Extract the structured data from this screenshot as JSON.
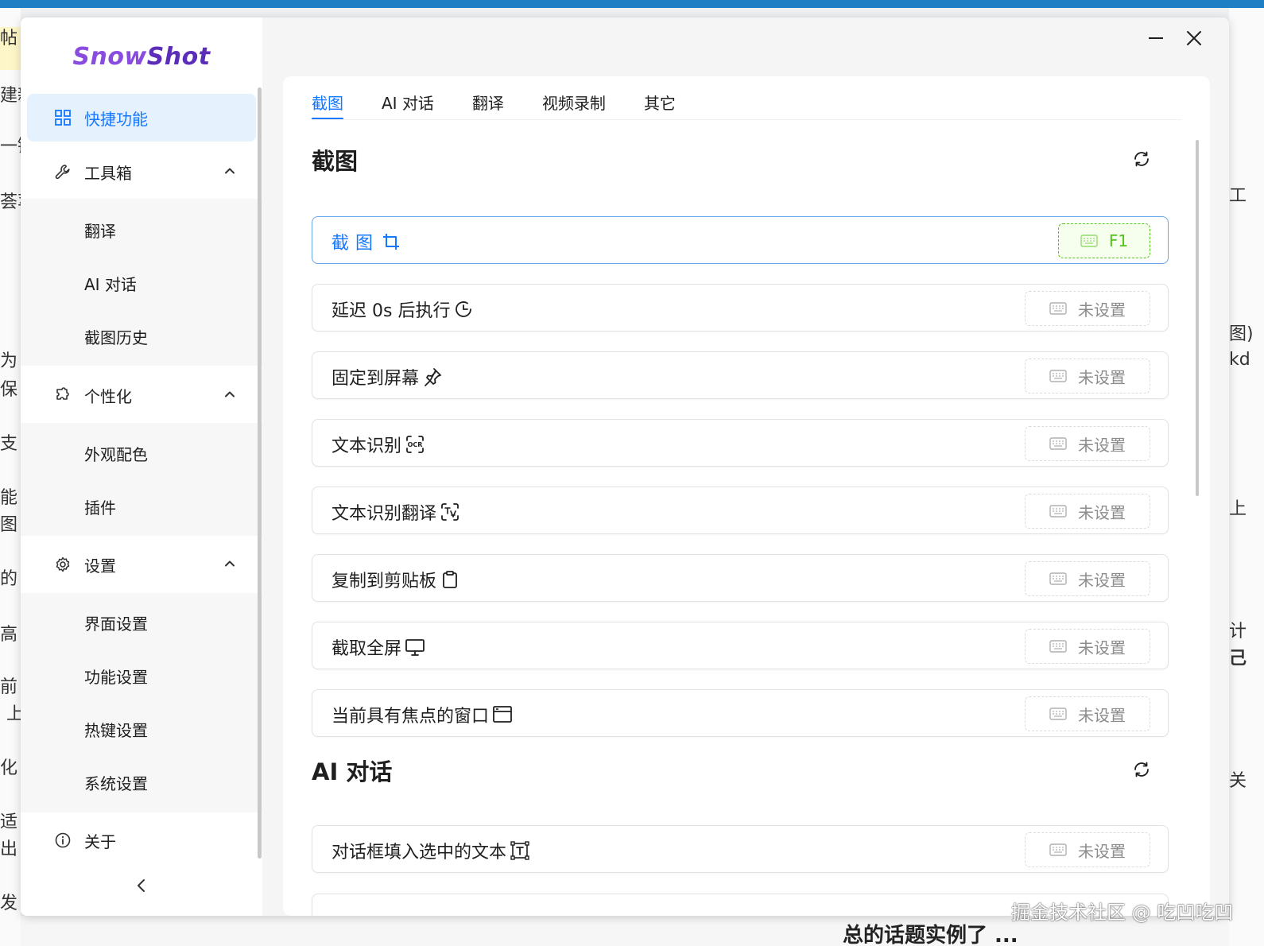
{
  "app": {
    "logo_snow": "Snow",
    "logo_shot": "Shot"
  },
  "sidebar": {
    "items": [
      {
        "label": "快捷功能",
        "icon": "grid-icon"
      },
      {
        "label": "工具箱",
        "icon": "wrench-icon"
      },
      {
        "label": "个性化",
        "icon": "puzzle-icon"
      },
      {
        "label": "设置",
        "icon": "gear-icon"
      },
      {
        "label": "关于",
        "icon": "info-icon"
      }
    ],
    "toolbox": [
      "翻译",
      "AI 对话",
      "截图历史"
    ],
    "personalize": [
      "外观配色",
      "插件"
    ],
    "settings": [
      "界面设置",
      "功能设置",
      "热键设置",
      "系统设置"
    ]
  },
  "tabs": [
    "截图",
    "AI 对话",
    "翻译",
    "视频录制",
    "其它"
  ],
  "sections": [
    {
      "title": "截图",
      "rows": [
        {
          "label": "截图",
          "icon": "crop-icon",
          "hotkey": "F1"
        },
        {
          "label": "延迟 0s 后执行",
          "icon": "timer-icon",
          "hotkey": "未设置"
        },
        {
          "label": "固定到屏幕",
          "icon": "pin-icon",
          "hotkey": "未设置"
        },
        {
          "label": "文本识别",
          "icon": "ocr-icon",
          "hotkey": "未设置"
        },
        {
          "label": "文本识别翻译",
          "icon": "scan-translate-icon",
          "hotkey": "未设置"
        },
        {
          "label": "复制到剪贴板",
          "icon": "clipboard-icon",
          "hotkey": "未设置"
        },
        {
          "label": "截取全屏",
          "icon": "monitor-icon",
          "hotkey": "未设置"
        },
        {
          "label": "当前具有焦点的窗口",
          "icon": "window-icon",
          "hotkey": "未设置"
        }
      ]
    },
    {
      "title": "AI 对话",
      "rows": [
        {
          "label": "对话框填入选中的文本",
          "icon": "text-select-icon",
          "hotkey": "未设置"
        }
      ]
    }
  ],
  "background": {
    "left_fragments": [
      "帖",
      "建新",
      "一键",
      "荟萃",
      "为",
      "保",
      "支",
      "能",
      "图",
      "的",
      "高",
      "前",
      "上",
      "化",
      "适",
      "出",
      "发"
    ],
    "right_fragments": [
      "工",
      "图)",
      "kd",
      "上",
      "计",
      "己",
      "关"
    ],
    "bottom_fragment": "总的话题实例了 ..."
  },
  "watermark": "掘金技术社区 @ 吃凹吃凹",
  "colors": {
    "accent": "#1677ff",
    "hotkey_set": "#52c41a",
    "logo": "#8a4bdf"
  }
}
